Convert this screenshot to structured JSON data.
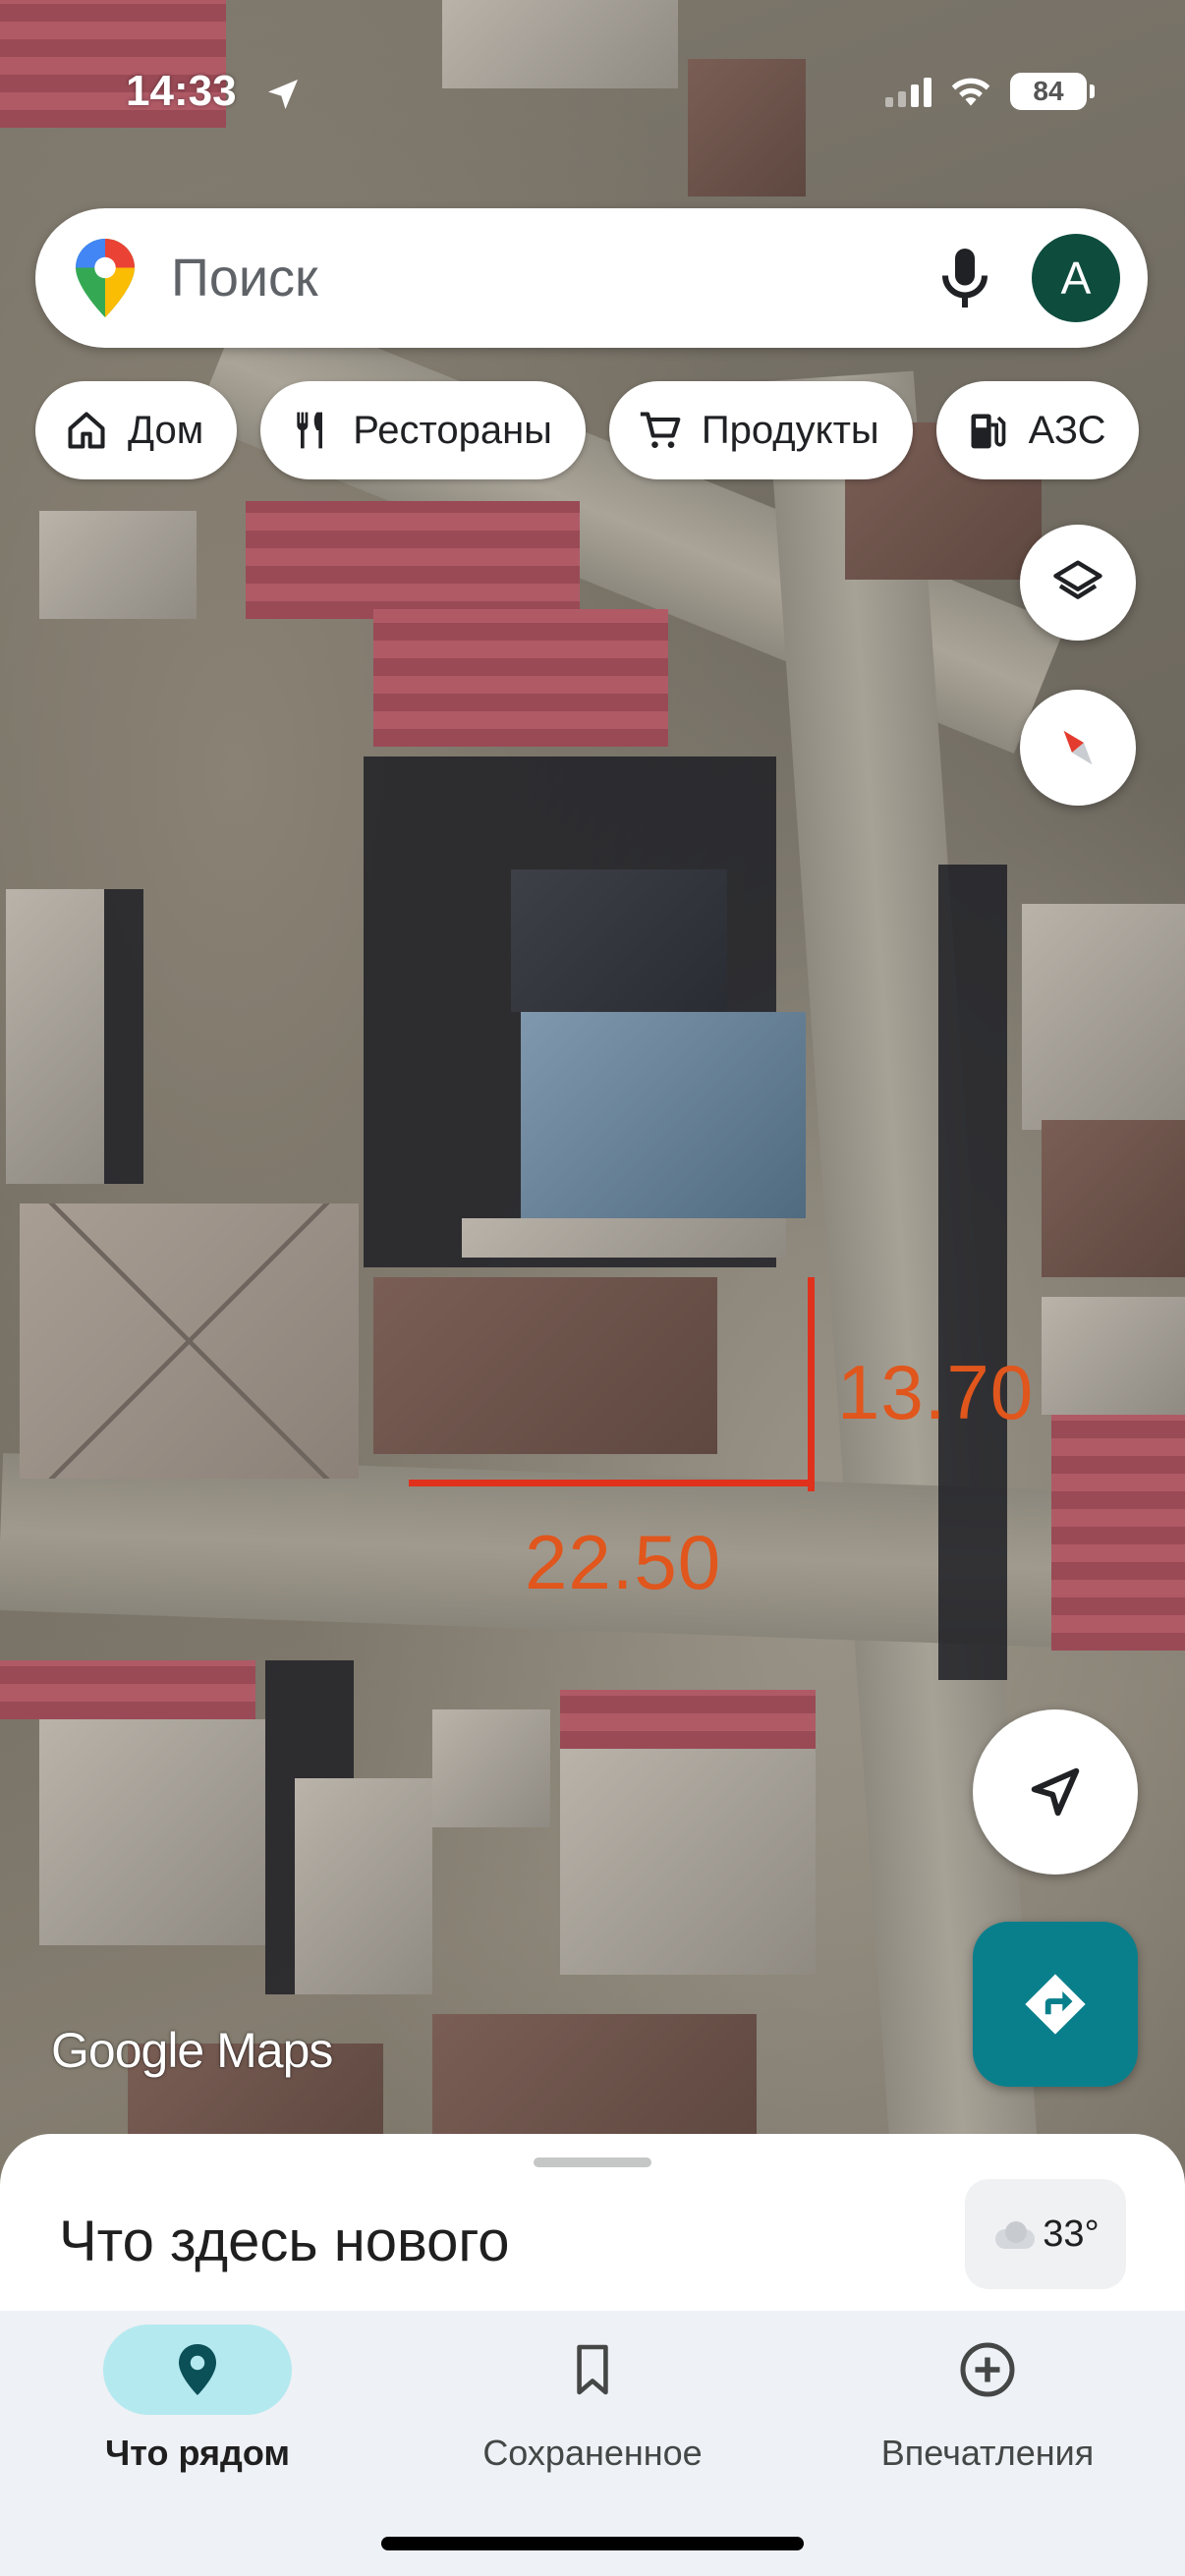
{
  "status_bar": {
    "time": "14:33",
    "battery": "84"
  },
  "search": {
    "placeholder": "Поиск",
    "avatar_letter": "A"
  },
  "chips": [
    {
      "label": "Дом",
      "icon": "home-icon"
    },
    {
      "label": "Рестораны",
      "icon": "fork-knife-icon"
    },
    {
      "label": "Продукты",
      "icon": "cart-icon"
    },
    {
      "label": "АЗС",
      "icon": "gas-station-icon"
    }
  ],
  "map": {
    "annotations": {
      "vertical": "13.70",
      "horizontal": "22.50"
    },
    "annotation_color": "#e0311c",
    "watermark": "Google Maps"
  },
  "sheet": {
    "title": "Что здесь нового",
    "temperature": "33°"
  },
  "nav": [
    {
      "label": "Что рядом",
      "icon": "explore-pin-icon",
      "active": true
    },
    {
      "label": "Сохраненное",
      "icon": "bookmark-icon",
      "active": false
    },
    {
      "label": "Впечатления",
      "icon": "add-circle-icon",
      "active": false
    }
  ],
  "colors": {
    "accent": "#0a7f8c",
    "avatar": "#0e4c3e",
    "nav_active": "#b5e9f0"
  }
}
